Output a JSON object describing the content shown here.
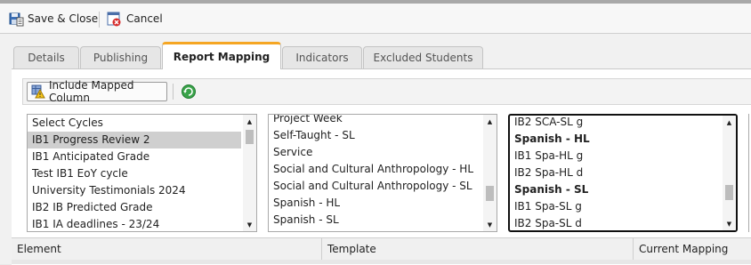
{
  "toolbar": {
    "save_close_label": "Save & Close",
    "cancel_label": "Cancel"
  },
  "tabs": [
    {
      "label": "Details",
      "active": false
    },
    {
      "label": "Publishing",
      "active": false
    },
    {
      "label": "Report Mapping",
      "active": true
    },
    {
      "label": "Indicators",
      "active": false
    },
    {
      "label": "Excluded Students",
      "active": false
    }
  ],
  "subtoolbar": {
    "include_mapped_label": "Include Mapped Column"
  },
  "cycles_list": {
    "items": [
      {
        "label": "Select Cycles",
        "selected": false
      },
      {
        "label": "IB1 Progress Review 2",
        "selected": true
      },
      {
        "label": "IB1 Anticipated Grade",
        "selected": false
      },
      {
        "label": "Test IB1 EoY cycle",
        "selected": false
      },
      {
        "label": "University Testimonials 2024",
        "selected": false
      },
      {
        "label": "IB2 IB Predicted Grade",
        "selected": false
      },
      {
        "label": "IB1 IA deadlines - 23/24",
        "selected": false
      }
    ]
  },
  "subjects_list": {
    "items": [
      {
        "label": "Project Week"
      },
      {
        "label": "Self-Taught - SL"
      },
      {
        "label": "Service"
      },
      {
        "label": "Social and Cultural Anthropology - HL"
      },
      {
        "label": "Social and Cultural Anthropology - SL"
      },
      {
        "label": "Spanish - HL"
      },
      {
        "label": "Spanish - SL"
      }
    ]
  },
  "classes_list": {
    "items": [
      {
        "label": "IB2 SCA-SL g",
        "group": false
      },
      {
        "label": "Spanish - HL",
        "group": true
      },
      {
        "label": "IB1 Spa-HL g",
        "group": false
      },
      {
        "label": "IB2 Spa-HL d",
        "group": false
      },
      {
        "label": "Spanish - SL",
        "group": true
      },
      {
        "label": "IB1 Spa-SL g",
        "group": false
      },
      {
        "label": "IB2 Spa-SL d",
        "group": false
      }
    ]
  },
  "grid": {
    "columns": [
      "Element",
      "Template",
      "Current Mapping"
    ]
  },
  "colors": {
    "active_tab_accent": "#f5a623",
    "selected_row": "#cfcfcf"
  },
  "icons": [
    "save-close-icon",
    "cancel-icon",
    "include-mapped-icon",
    "refresh-icon"
  ]
}
